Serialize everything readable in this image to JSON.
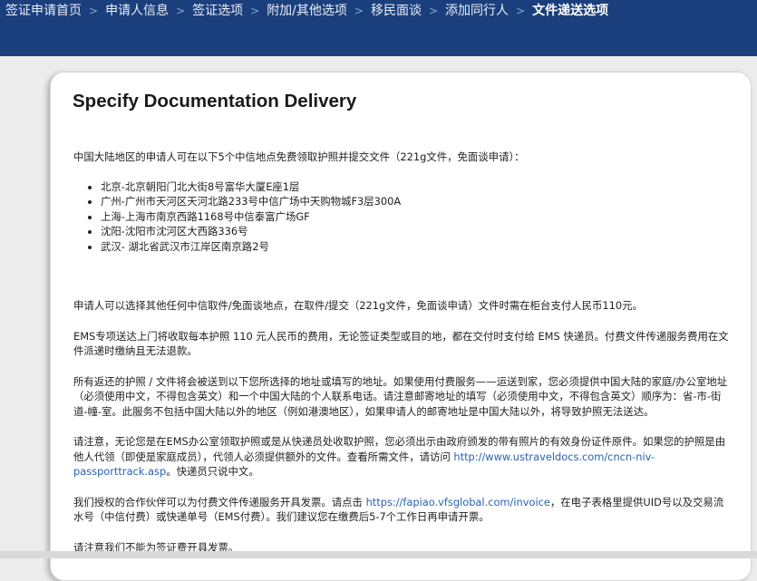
{
  "breadcrumb": {
    "items": [
      {
        "label": "签证申请首页"
      },
      {
        "label": "申请人信息"
      },
      {
        "label": "签证选项"
      },
      {
        "label": "附加/其他选项"
      },
      {
        "label": "移民面谈"
      },
      {
        "label": "添加同行人"
      },
      {
        "label": "文件递送选项"
      }
    ],
    "separator": ">"
  },
  "page": {
    "title": "Specify Documentation Delivery"
  },
  "content": {
    "intro": "中国大陆地区的申请人可在以下5个中信地点免费领取护照并提交文件（221g文件，免面谈申请）：",
    "locations": [
      "北京-北京朝阳门北大街8号富华大厦E座1层",
      "广州-广州市天河区天河北路233号中信广场中天购物城F3层300A",
      "上海-上海市南京西路1168号中信泰富广场GF",
      "沈阳-沈阳市沈河区大西路336号",
      "武汉- 湖北省武汉市江岸区南京路2号"
    ],
    "fee_note": "申请人可以选择其他任何中信取件/免面谈地点，在取件/提交（221g文件，免面谈申请）文件时需在柜台支付人民币110元。",
    "ems_note": "EMS专项送达上门将收取每本护照 110 元人民币的费用，无论签证类型或目的地，都在交付时支付给 EMS 快递员。付费文件传递服务费用在文件派递时缴纳且无法退款。",
    "address_note": "所有返还的护照 / 文件将会被送到以下您所选择的地址或填写的地址。如果使用付费服务——运送到家，您必须提供中国大陆的家庭/办公室地址（必须使用中文，不得包含英文）和一个中国大陆的个人联系电话。请注意邮寄地址的填写（必须使用中文，不得包含英文）顺序为：省-市-街道-幢-室。此服务不包括中国大陆以外的地区（例如港澳地区），如果申请人的邮寄地址是中国大陆以外，将导致护照无法送达。",
    "id_note_before": "请注意，无论您是在EMS办公室领取护照或是从快递员处收取护照，您必须出示由政府颁发的带有照片的有效身份证件原件。如果您的护照是由他人代领（即使是家庭成员），代领人必须提供额外的文件。查看所需文件，请访问 ",
    "id_note_link": "http://www.ustraveldocs.com/cncn-niv-passporttrack.asp",
    "id_note_after": "。快递员只说中文。",
    "invoice_note_before": "我们授权的合作伙伴可以为付费文件传递服务开具发票。请点击 ",
    "invoice_note_link": "https://fapiao.vfsglobal.com/invoice",
    "invoice_note_after": "，在电子表格里提供UID号以及交易流水号（中信付费）或快递单号（EMS付费）。我们建议您在缴费后5-7个工作日再申请开票。",
    "no_invoice_note": "请注意我们不能为签证费开具发票。"
  },
  "colors": {
    "header_bg": "#1b3f7d",
    "link": "#2a62b3"
  }
}
